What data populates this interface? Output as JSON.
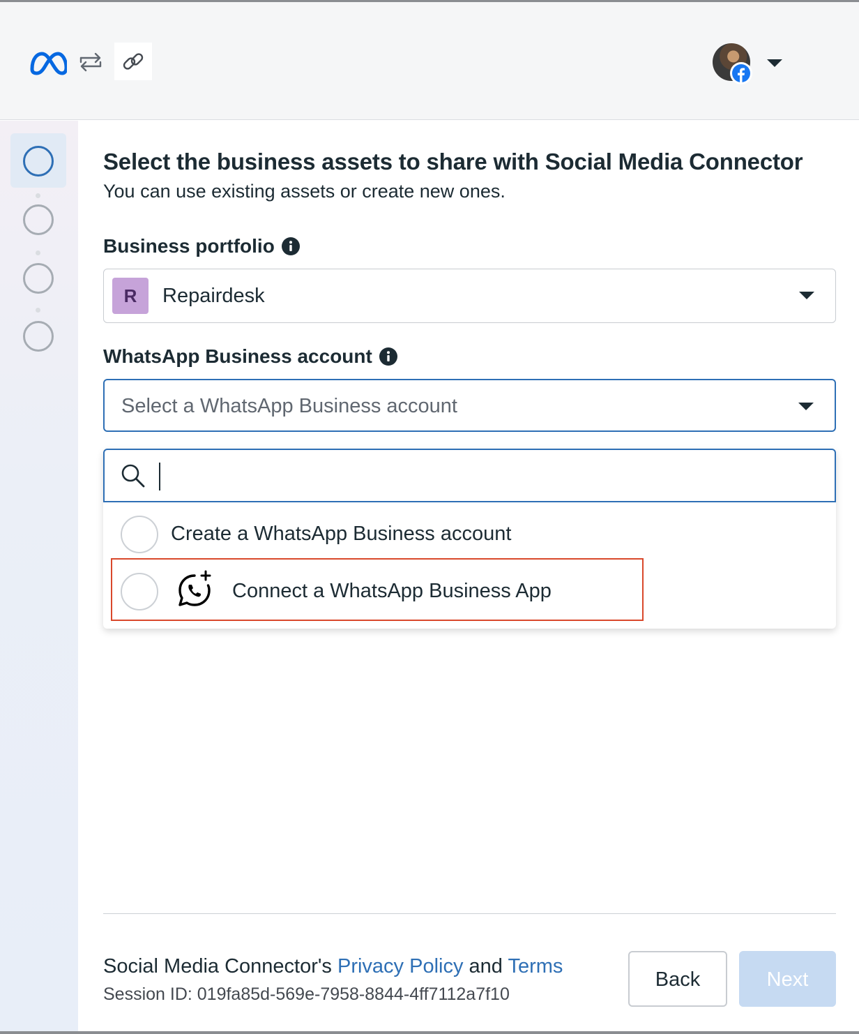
{
  "header": {
    "icons": [
      "meta-logo-icon",
      "swap-icon",
      "link-icon",
      "avatar",
      "facebook-icon",
      "chevron-down-icon"
    ]
  },
  "sidebar": {
    "steps": 4,
    "active_step": 1
  },
  "main": {
    "title": "Select the business assets to share with Social Media Connector",
    "subtitle": "You can use existing assets or create new ones.",
    "portfolio": {
      "label": "Business portfolio",
      "badge": "R",
      "value": "Repairdesk"
    },
    "waba": {
      "label": "WhatsApp Business account",
      "placeholder": "Select a WhatsApp Business account",
      "search_value": "",
      "options": [
        {
          "label": "Create a WhatsApp Business account"
        },
        {
          "label": "Connect a WhatsApp Business App"
        }
      ]
    }
  },
  "footer": {
    "prefix": "Social Media Connector's",
    "privacy_link": "Privacy Policy",
    "and_text": "and",
    "terms_link": "Terms",
    "session": "Session ID: 019fa85d-569e-7958-8844-4ff7112a7f10",
    "back_label": "Back",
    "next_label": "Next"
  },
  "colors": {
    "accent": "#2e6fb5",
    "highlight": "#d9482b",
    "next_disabled": "#c6daf2",
    "meta_blue": "#0668e1"
  }
}
